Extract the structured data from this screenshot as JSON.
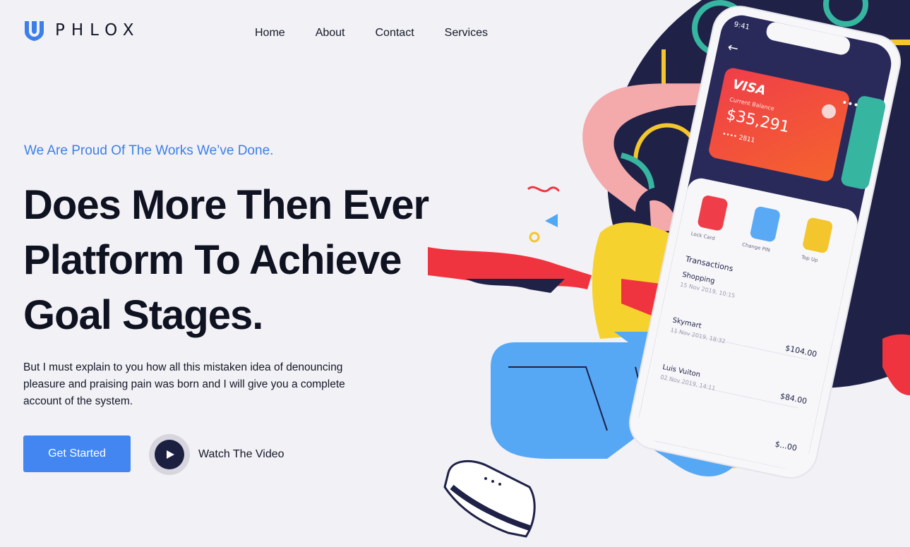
{
  "brand": {
    "name": "PHLOX",
    "icon": "shield-logo-icon",
    "color": "#3d7fe8"
  },
  "nav": {
    "items": [
      {
        "label": "Home"
      },
      {
        "label": "About"
      },
      {
        "label": "Contact"
      },
      {
        "label": "Services"
      }
    ]
  },
  "hero": {
    "eyebrow": "We Are Proud Of The Works We’ve Done.",
    "headline_lines": [
      "Does More Then Ever",
      "Platform To Achieve",
      "Goal Stages."
    ],
    "body": "But I must explain to you how all this mistaken idea of denouncing pleasure and praising pain was born and I will give you a complete account of the system.",
    "cta_label": "Get Started",
    "video_label": "Watch The Video",
    "video_icon": "play-icon"
  },
  "phone": {
    "time": "9:41",
    "card": {
      "brand": "VISA",
      "balance_label": "Current Balance",
      "balance": "$35,291",
      "number": "•••• 2811"
    },
    "actions": [
      {
        "label": "Lock Card",
        "icon": "lock-card-icon",
        "color": "#ef3e4a"
      },
      {
        "label": "Change PIN",
        "icon": "shield-icon",
        "color": "#5aa9f4"
      },
      {
        "label": "Top Up",
        "icon": "wallet-icon",
        "color": "#f3c62d"
      }
    ],
    "transactions_title": "Transactions",
    "transactions": [
      {
        "name": "Shopping",
        "date": "15 Nov 2019, 10:15",
        "amount": ""
      },
      {
        "name": "Skymart",
        "date": "11 Nov 2019, 18:32",
        "amount": "$104.00"
      },
      {
        "name": "Luis Vuiton",
        "date": "02 Nov 2019, 14:11",
        "amount": "$84.00"
      },
      {
        "name": "",
        "date": "",
        "amount": "$...00"
      }
    ]
  },
  "colors": {
    "accent": "#4386f2",
    "dark": "#1f2147",
    "text": "#0f1220",
    "bg": "#f2f1f6"
  }
}
